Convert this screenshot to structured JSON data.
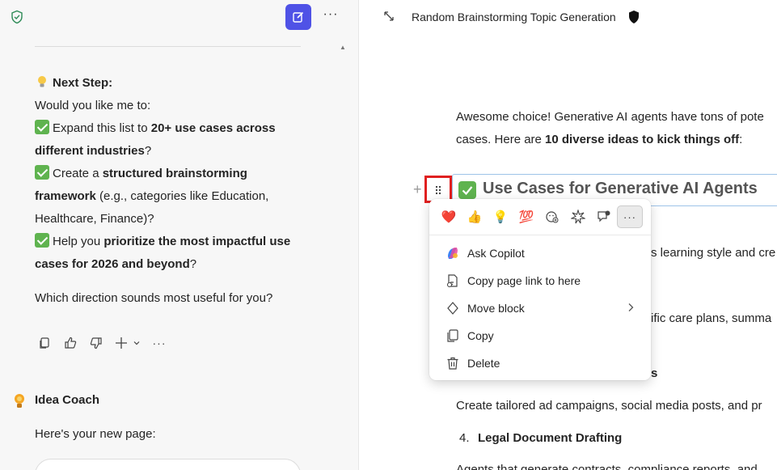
{
  "left": {
    "chat": {
      "next_step_heading": "Next Step:",
      "question": "Would you like me to:",
      "item1_pre": "Expand this list to ",
      "item1_bold": "20+ use cases across different industries",
      "item1_post": "?",
      "item2_pre": "Create a ",
      "item2_bold": "structured brainstorming framework",
      "item2_post": " (e.g., categories like Education, Healthcare, Finance)?",
      "item3_pre": "Help you ",
      "item3_bold": "prioritize the most impactful use cases for 2026 and beyond",
      "item3_post": "?",
      "closing": "Which direction sounds most useful for you?"
    },
    "coach": {
      "name": "Idea Coach",
      "text": "Here's your new page:"
    },
    "more_label": "···"
  },
  "right": {
    "page_title": "Random Brainstorming Topic Generation",
    "intro_line1": "Awesome choice! Generative AI agents have tons of pote",
    "intro_line2_pre": "cases. Here are ",
    "intro_line2_bold": "10 diverse ideas to kick things off",
    "intro_line2_post": ":",
    "heading": "Use Cases for Generative AI Agents",
    "plus_glyph": "+",
    "frag1": "s learning style and cre",
    "frag2": "ific care plans, summa",
    "frag3": "s",
    "line_ad": "Create tailored ad campaigns, social media posts, and pr",
    "item4_num": "4.",
    "item4_title": "Legal Document Drafting",
    "line_last": "Agents that generate contracts, compliance reports, and"
  },
  "menu": {
    "reactions": [
      "❤️",
      "👍",
      "💡",
      "💯"
    ],
    "more": "···",
    "items": [
      {
        "label": "Ask Copilot",
        "icon": "copilot-icon"
      },
      {
        "label": "Copy page link to here",
        "icon": "link-icon"
      },
      {
        "label": "Move block",
        "icon": "move-icon",
        "arrow": "›"
      },
      {
        "label": "Copy",
        "icon": "copy-icon"
      },
      {
        "label": "Delete",
        "icon": "trash-icon"
      }
    ]
  },
  "colors": {
    "accent": "#4f52e6",
    "highlight": "#e02020",
    "check": "#5fb34f"
  }
}
